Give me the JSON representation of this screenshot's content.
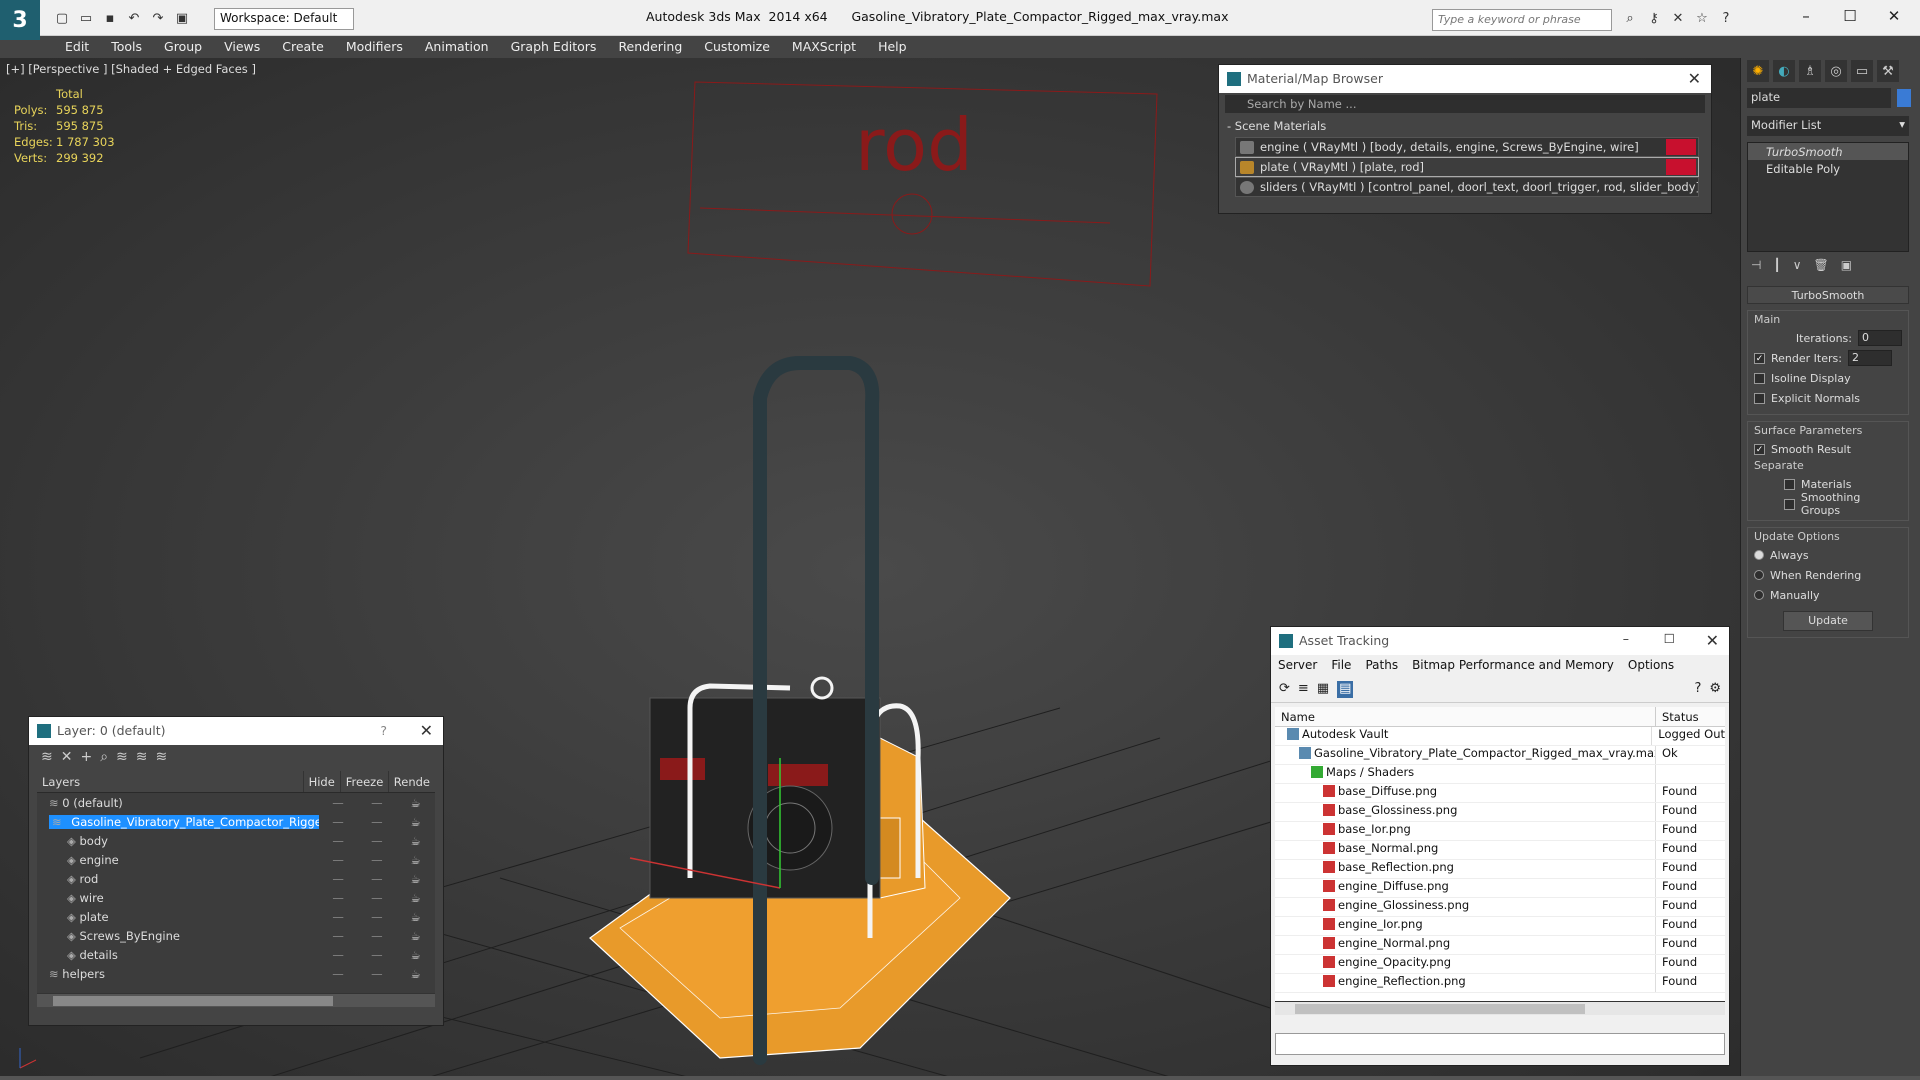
{
  "app": {
    "title": "Autodesk 3ds Max  2014 x64      Gasoline_Vibratory_Plate_Compactor_Rigged_max_vray.max",
    "workspace": "Workspace: Default",
    "search_placeholder": "Type a keyword or phrase"
  },
  "menu": [
    "Edit",
    "Tools",
    "Group",
    "Views",
    "Create",
    "Modifiers",
    "Animation",
    "Graph Editors",
    "Rendering",
    "Customize",
    "MAXScript",
    "Help"
  ],
  "viewport": {
    "label": "[+] [Perspective ] [Shaded + Edged Faces ]",
    "stats_header": "Total",
    "stats": [
      {
        "k": "Polys:",
        "v": "595 875"
      },
      {
        "k": "Tris:",
        "v": "595 875"
      },
      {
        "k": "Edges:",
        "v": "1 787 303"
      },
      {
        "k": "Verts:",
        "v": "299 392"
      }
    ],
    "sign_text": "rod"
  },
  "material_browser": {
    "title": "Material/Map Browser",
    "search": "Search by Name ...",
    "section": "- Scene Materials",
    "rows": [
      "engine  ( VRayMtl )  [body, details, engine, Screws_ByEngine, wire]",
      "plate  ( VRayMtl )  [plate, rod]",
      "sliders  ( VRayMtl ) [control_panel, doorl_text, doorl_trigger, rod, slider_body]"
    ]
  },
  "layer_panel": {
    "title": "Layer: 0 (default)",
    "help": "?",
    "headers": {
      "layers": "Layers",
      "hide": "Hide",
      "freeze": "Freeze",
      "render": "Rende"
    },
    "rows": [
      {
        "name": "0 (default)",
        "indent": 1
      },
      {
        "name": "Gasoline_Vibratory_Plate_Compactor_Rigged",
        "indent": 1,
        "selected": true
      },
      {
        "name": "body",
        "indent": 2
      },
      {
        "name": "engine",
        "indent": 2
      },
      {
        "name": "rod",
        "indent": 2
      },
      {
        "name": "wire",
        "indent": 2
      },
      {
        "name": "plate",
        "indent": 2
      },
      {
        "name": "Screws_ByEngine",
        "indent": 2
      },
      {
        "name": "details",
        "indent": 2
      },
      {
        "name": "helpers",
        "indent": 1
      }
    ]
  },
  "asset_tracking": {
    "title": "Asset Tracking",
    "menu": [
      "Server",
      "File",
      "Paths",
      "Bitmap Performance and Memory",
      "Options"
    ],
    "headers": {
      "name": "Name",
      "status": "Status"
    },
    "rows": [
      {
        "name": "Autodesk Vault",
        "status": "Logged Out",
        "indent": 1
      },
      {
        "name": "Gasoline_Vibratory_Plate_Compactor_Rigged_max_vray.max",
        "status": "Ok",
        "indent": 2
      },
      {
        "name": "Maps / Shaders",
        "status": "",
        "indent": 3
      },
      {
        "name": "base_Diffuse.png",
        "status": "Found",
        "indent": 4
      },
      {
        "name": "base_Glossiness.png",
        "status": "Found",
        "indent": 4
      },
      {
        "name": "base_Ior.png",
        "status": "Found",
        "indent": 4
      },
      {
        "name": "base_Normal.png",
        "status": "Found",
        "indent": 4
      },
      {
        "name": "base_Reflection.png",
        "status": "Found",
        "indent": 4
      },
      {
        "name": "engine_Diffuse.png",
        "status": "Found",
        "indent": 4
      },
      {
        "name": "engine_Glossiness.png",
        "status": "Found",
        "indent": 4
      },
      {
        "name": "engine_Ior.png",
        "status": "Found",
        "indent": 4
      },
      {
        "name": "engine_Normal.png",
        "status": "Found",
        "indent": 4
      },
      {
        "name": "engine_Opacity.png",
        "status": "Found",
        "indent": 4
      },
      {
        "name": "engine_Reflection.png",
        "status": "Found",
        "indent": 4
      }
    ]
  },
  "command_panel": {
    "object_name": "plate",
    "modifier_list": "Modifier List",
    "stack": [
      "TurboSmooth",
      "Editable Poly"
    ],
    "rollout_title": "TurboSmooth",
    "main_label": "Main",
    "iterations_label": "Iterations:",
    "iterations_value": "0",
    "render_iters_label": "Render Iters:",
    "render_iters_value": "2",
    "isoline": "Isoline Display",
    "explicit": "Explicit Normals",
    "surface_label": "Surface Parameters",
    "smooth_result": "Smooth Result",
    "separate_label": "Separate",
    "materials": "Materials",
    "smoothing_groups": "Smoothing Groups",
    "update_label": "Update Options",
    "always": "Always",
    "when_rendering": "When Rendering",
    "manually": "Manually",
    "update_button": "Update"
  },
  "colors": {
    "accent": "#1e90ff",
    "wire_orange": "#f0a020",
    "selection_red": "#c8102e"
  }
}
